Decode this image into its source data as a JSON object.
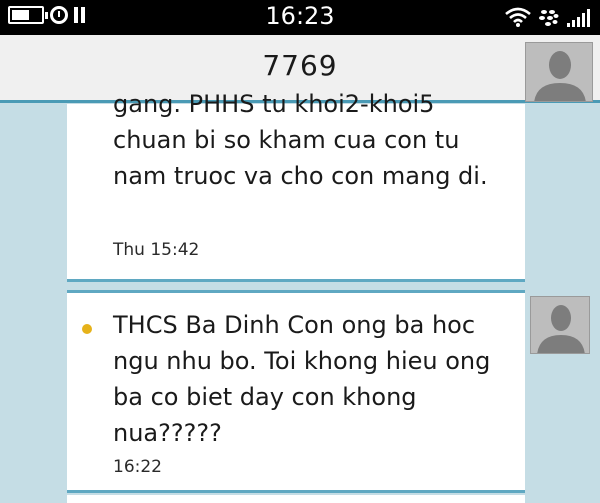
{
  "status_bar": {
    "time": "16:23",
    "icons": [
      "battery-icon",
      "alarm-icon",
      "pause-icon",
      "wifi-icon",
      "blackberry-icon",
      "signal-icon"
    ],
    "battery_level": 0.6
  },
  "header": {
    "title": "7769",
    "avatar_icon": "contact-silhouette-icon"
  },
  "messages": [
    {
      "text": "gang. PHHS tu khoi2-khoi5\nchuan bi so kham cua con tu\nnam truoc va cho con mang di.",
      "time": "Thu 15:42",
      "unread": false
    },
    {
      "text": "THCS Ba Dinh Con ong ba hoc\nngu nhu bo. Toi khong hieu ong\nba co biet day con khong\nnua?????",
      "time": "16:22",
      "unread": true,
      "avatar_icon": "contact-silhouette-icon"
    }
  ],
  "colors": {
    "background": "#c5dde5",
    "accent": "#4a9ab5",
    "unread_dot": "#e6b21a"
  }
}
